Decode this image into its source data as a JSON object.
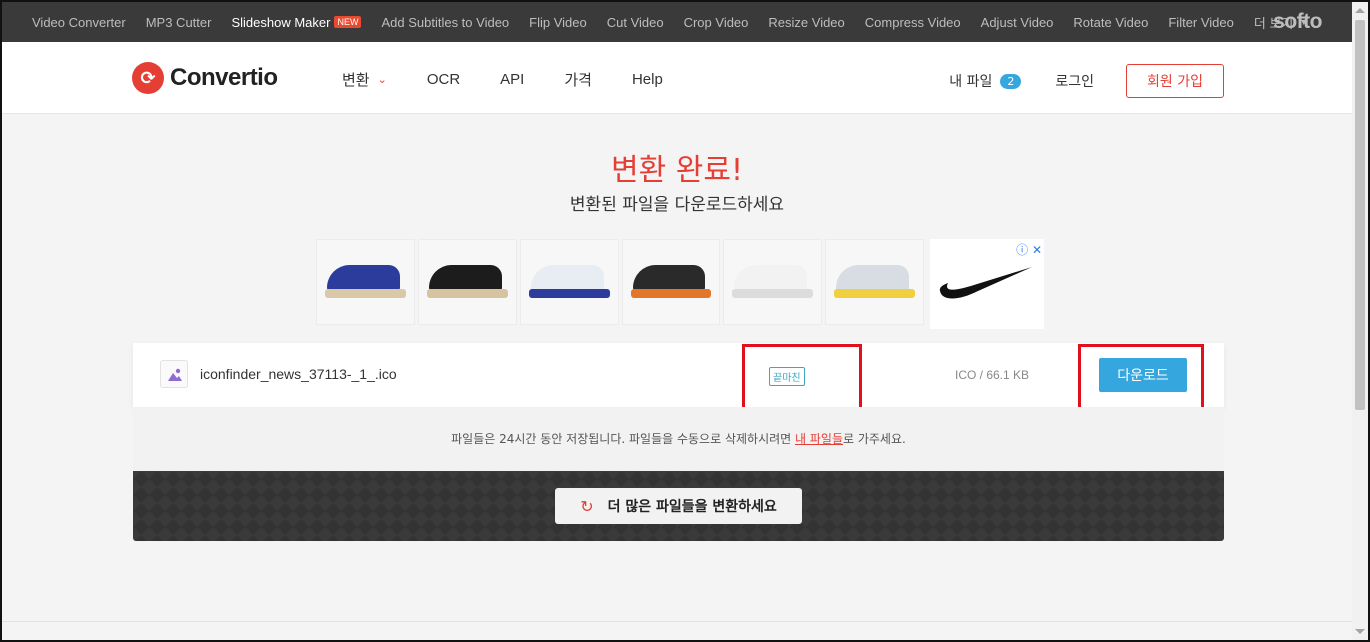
{
  "softo_bar": {
    "links": [
      {
        "label": "Video Converter"
      },
      {
        "label": "MP3 Cutter"
      },
      {
        "label": "Slideshow Maker",
        "badge": "NEW"
      },
      {
        "label": "Add Subtitles to Video"
      },
      {
        "label": "Flip Video"
      },
      {
        "label": "Cut Video"
      },
      {
        "label": "Crop Video"
      },
      {
        "label": "Resize Video"
      },
      {
        "label": "Compress Video"
      },
      {
        "label": "Adjust Video"
      },
      {
        "label": "Rotate Video"
      },
      {
        "label": "Filter Video"
      }
    ],
    "more_label": "더 보기",
    "logo": "softo"
  },
  "header": {
    "logo_text": "Convertio",
    "nav": [
      "변환",
      "OCR",
      "API",
      "가격",
      "Help"
    ],
    "my_files_label": "내 파일",
    "my_files_count": "2",
    "login_label": "로그인",
    "signup_label": "회원 가입"
  },
  "page": {
    "title": "변환 완료!",
    "subtitle": "변환된 파일을 다운로드하세요"
  },
  "ad": {
    "shoe_colors": [
      {
        "body": "#2b3c9c",
        "sole": "#d9c9a8"
      },
      {
        "body": "#1c1c1c",
        "sole": "#d6c4a0"
      },
      {
        "body": "#e8ecf3",
        "sole": "#2b3c9c"
      },
      {
        "body": "#2a2a2a",
        "sole": "#e2762a"
      },
      {
        "body": "#f2f2f2",
        "sole": "#dcdcdc"
      },
      {
        "body": "#d8dde3",
        "sole": "#f0d040"
      }
    ]
  },
  "file": {
    "name": "iconfinder_news_37113-_1_.ico",
    "status": "끝마친",
    "meta": "ICO / 66.1 KB",
    "download_label": "다운로드"
  },
  "notice": {
    "text_before": "파일들은 24시간 동안 저장됩니다. 파일들을 수동으로 삭제하시려면 ",
    "link_text": "내 파일들",
    "text_after": "로 가주세요."
  },
  "convert_more_label": "더 많은 파일들을 변환하세요",
  "colors": {
    "brand_red": "#e53e35",
    "accent_blue": "#35a7de",
    "highlight_red": "#e0101c"
  }
}
